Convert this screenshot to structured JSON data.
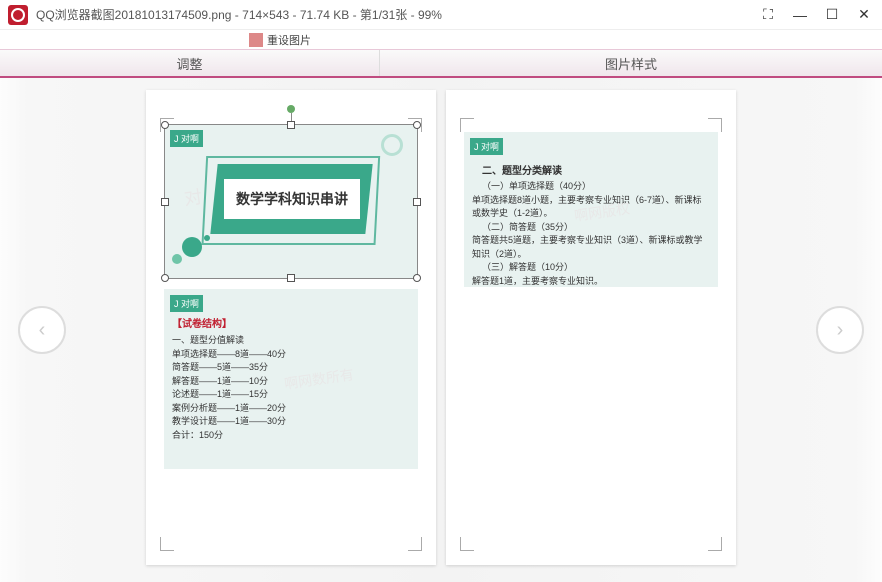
{
  "titlebar": {
    "filename": "QQ浏览器截图20181013174509.png",
    "dimensions": "714×543",
    "filesize": "71.74 KB",
    "page_indicator": "第1/31张",
    "zoom": "99%"
  },
  "ribbon": {
    "reset_image": "重设图片"
  },
  "tabs": {
    "adjust": "调整",
    "image_style": "图片样式"
  },
  "page1": {
    "slide1": {
      "logo": "J 对啊",
      "title": "数学学科知识串讲"
    },
    "slide2": {
      "logo": "J 对啊",
      "section_title": "【试卷结构】",
      "heading": "一、题型分值解读",
      "lines": [
        "单项选择题——8道——40分",
        "简答题——5道——35分",
        "解答题——1道——10分",
        "论述题——1道——15分",
        "案例分析题——1道——20分",
        "教学设计题——1道——30分",
        "合计：150分"
      ]
    }
  },
  "page2": {
    "slide": {
      "logo": "J 对啊",
      "heading": "二、题型分类解读",
      "sub1": "（一）单项选择题（40分）",
      "line1": "单项选择题8道小题，主要考察专业知识（6-7道）、新课标或数学史（1-2道）。",
      "sub2": "（二）简答题（35分）",
      "line2": "简答题共5道题，主要考察专业知识（3道）、新课标或教学知识（2道）。",
      "sub3": "（三）解答题（10分）",
      "line3": "解答题1道，主要考察专业知识。"
    }
  }
}
